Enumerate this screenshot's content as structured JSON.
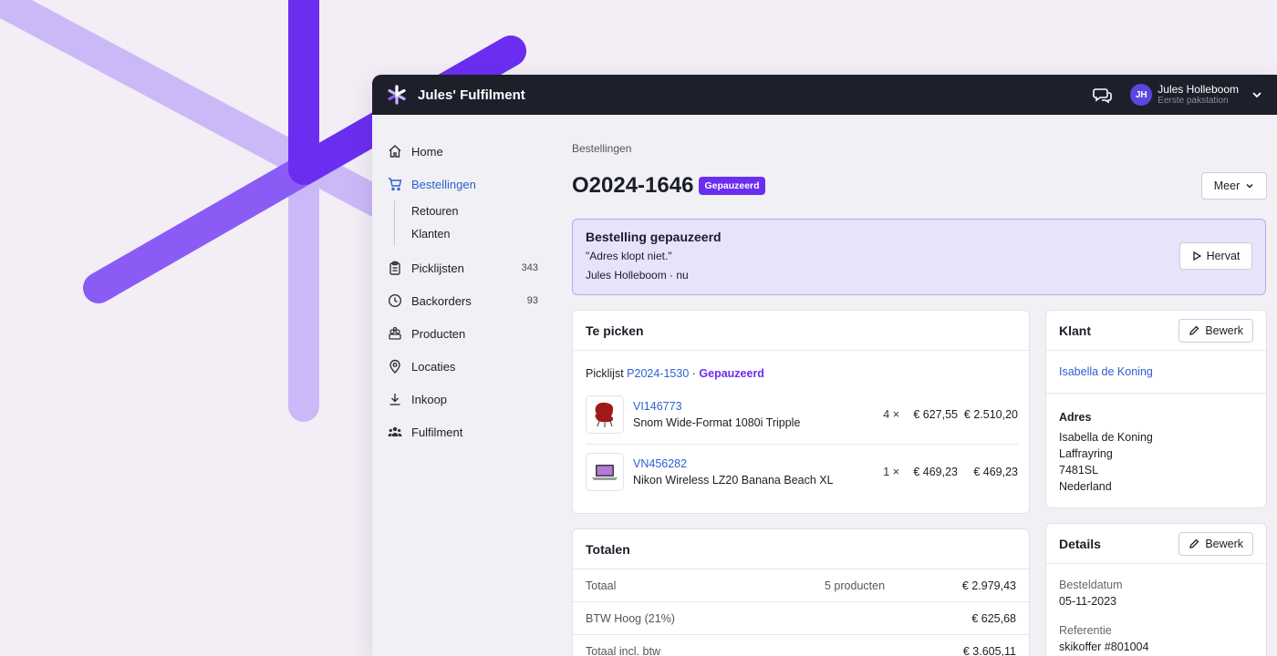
{
  "app": {
    "title": "Jules' Fulfilment"
  },
  "user": {
    "initials": "JH",
    "name": "Jules Holleboom",
    "station": "Eerste pakstation"
  },
  "nav": {
    "home": "Home",
    "orders": "Bestellingen",
    "returns": "Retouren",
    "customers": "Klanten",
    "picklists": "Picklijsten",
    "picklists_count": "343",
    "backorders": "Backorders",
    "backorders_count": "93",
    "products": "Producten",
    "locations": "Locaties",
    "purchasing": "Inkoop",
    "fulfilment": "Fulfilment"
  },
  "breadcrumb": "Bestellingen",
  "order": {
    "number": "O2024-1646",
    "status": "Gepauzeerd",
    "more_label": "Meer"
  },
  "alert": {
    "title": "Bestelling gepauzeerd",
    "message": "\"Adres klopt niet.\"",
    "meta": "Jules Holleboom · nu",
    "resume_label": "Hervat"
  },
  "to_pick": {
    "title": "Te picken",
    "picklist_prefix": "Picklijst",
    "picklist_id": "P2024-1530",
    "picklist_sep": " · ",
    "picklist_status": "Gepauzeerd",
    "items": [
      {
        "sku": "VI146773",
        "name": "Snom Wide-Format 1080i Tripple",
        "qty": "4 ×",
        "price": "€ 627,55",
        "total": "€ 2.510,20",
        "icon": "red-chair-icon"
      },
      {
        "sku": "VN456282",
        "name": "Nikon Wireless LZ20 Banana Beach XL",
        "qty": "1 ×",
        "price": "€ 469,23",
        "total": "€ 469,23",
        "icon": "laptop-icon"
      }
    ]
  },
  "totals": {
    "title": "Totalen",
    "rows": [
      {
        "label": "Totaal",
        "mid": "5 producten",
        "value": "€ 2.979,43"
      },
      {
        "label": "BTW Hoog (21%)",
        "mid": "",
        "value": "€ 625,68"
      },
      {
        "label": "Totaal incl. btw",
        "mid": "",
        "value": "€ 3.605,11"
      }
    ]
  },
  "customer": {
    "title": "Klant",
    "edit_label": "Bewerk",
    "name": "Isabella de Koning",
    "address_title": "Adres",
    "address_lines": [
      "Isabella de Koning",
      "Laffrayring",
      "7481SL",
      "Nederland"
    ]
  },
  "details": {
    "title": "Details",
    "edit_label": "Bewerk",
    "order_date_label": "Besteldatum",
    "order_date": "05-11-2023",
    "reference_label": "Referentie",
    "reference": "skikoffer #801004"
  },
  "colors": {
    "accent": "#6b2ef0",
    "link": "#2d5fd3",
    "topbar": "#1d1f2b",
    "alert_bg": "#e8e2fb"
  }
}
